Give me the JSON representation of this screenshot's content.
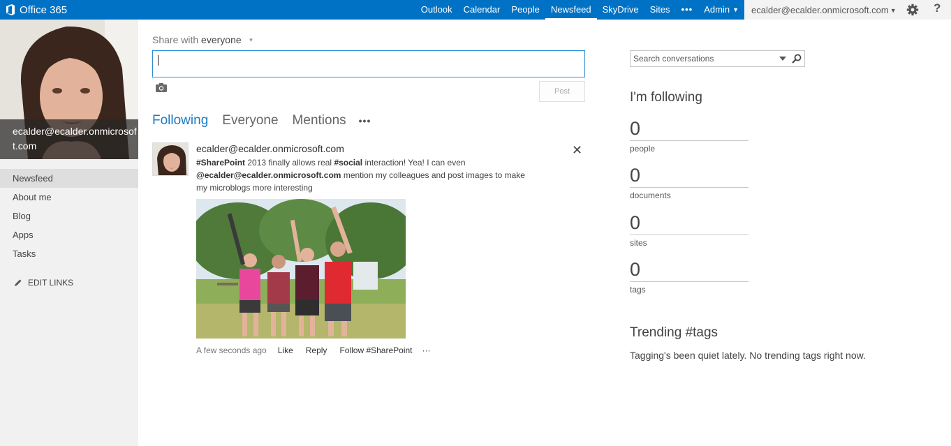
{
  "suite": {
    "brand": "Office 365",
    "nav": [
      "Outlook",
      "Calendar",
      "People",
      "Newsfeed",
      "SkyDrive",
      "Sites"
    ],
    "more": "•••",
    "admin": "Admin",
    "user_email": "ecalder@ecalder.onmicrosoft.com",
    "help": "?",
    "active_nav": "Newsfeed"
  },
  "left": {
    "profile_name": "ecalder@ecalder.onmicrosoft.com",
    "nav": [
      "Newsfeed",
      "About me",
      "Blog",
      "Apps",
      "Tasks"
    ],
    "edit_links": "EDIT LINKS"
  },
  "share": {
    "prefix": "Share with",
    "audience": "everyone",
    "post_button": "Post"
  },
  "tabs": [
    "Following",
    "Everyone",
    "Mentions"
  ],
  "tabs_more": "•••",
  "post": {
    "author": "ecalder@ecalder.onmicrosoft.com",
    "close": "✕",
    "text_parts": {
      "tag1": "#SharePoint",
      "t1": " 2013 finally allows real ",
      "tag2": "#social",
      "t2": " interaction! Yea! I can even ",
      "mention": "@ecalder@ecalder.onmicrosoft.com",
      "t3": " mention my colleagues and post images to make my microblogs more interesting"
    },
    "timestamp": "A few seconds ago",
    "actions": [
      "Like",
      "Reply",
      "Follow #SharePoint"
    ],
    "more": "···"
  },
  "right": {
    "search_placeholder": "Search conversations",
    "following_title": "I'm following",
    "stats": [
      {
        "count": "0",
        "label": "people"
      },
      {
        "count": "0",
        "label": "documents"
      },
      {
        "count": "0",
        "label": "sites"
      },
      {
        "count": "0",
        "label": "tags"
      }
    ],
    "trending_title": "Trending #tags",
    "trending_text": "Tagging's been quiet lately. No trending tags right now."
  },
  "colors": {
    "suite_blue": "#0072c6",
    "link_blue": "#1e7bc4",
    "left_bg": "#f1f1f1"
  }
}
